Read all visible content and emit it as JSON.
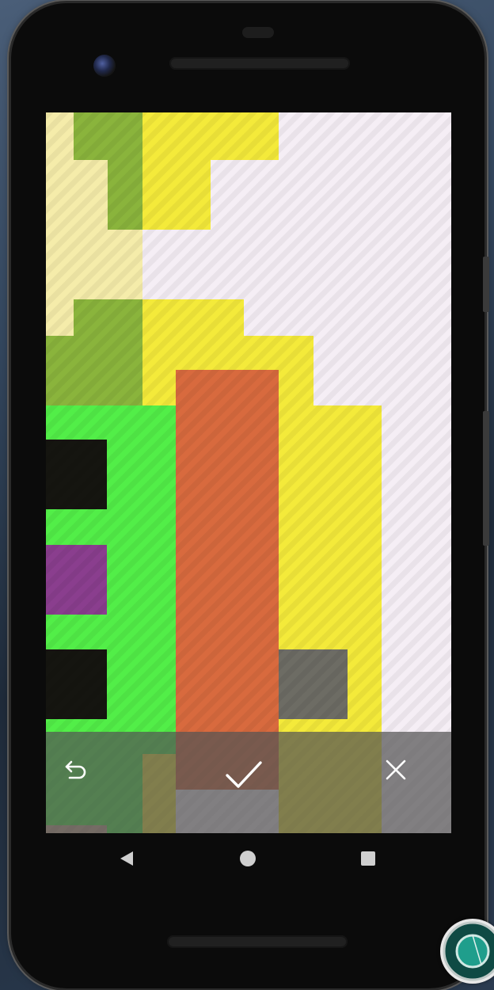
{
  "screen": {
    "accent": "#f5eef5",
    "actions": [
      {
        "name": "undo",
        "icon": "undo-icon"
      },
      {
        "name": "confirm",
        "icon": "check-icon"
      },
      {
        "name": "cancel",
        "icon": "close-icon"
      }
    ]
  },
  "navigation": {
    "buttons": [
      {
        "name": "back",
        "icon": "back-triangle-icon"
      },
      {
        "name": "home",
        "icon": "home-circle-icon"
      },
      {
        "name": "recents",
        "icon": "recents-square-icon"
      }
    ]
  },
  "colors": {
    "yellow": "#f4ea3a",
    "pale_yellow": "#f5ecaa",
    "olive": "#8ab43c",
    "green": "#52ee48",
    "orange": "#d86a3e",
    "purple": "#8a3e8e",
    "black": "#151510",
    "gray": "#6d6c64"
  }
}
